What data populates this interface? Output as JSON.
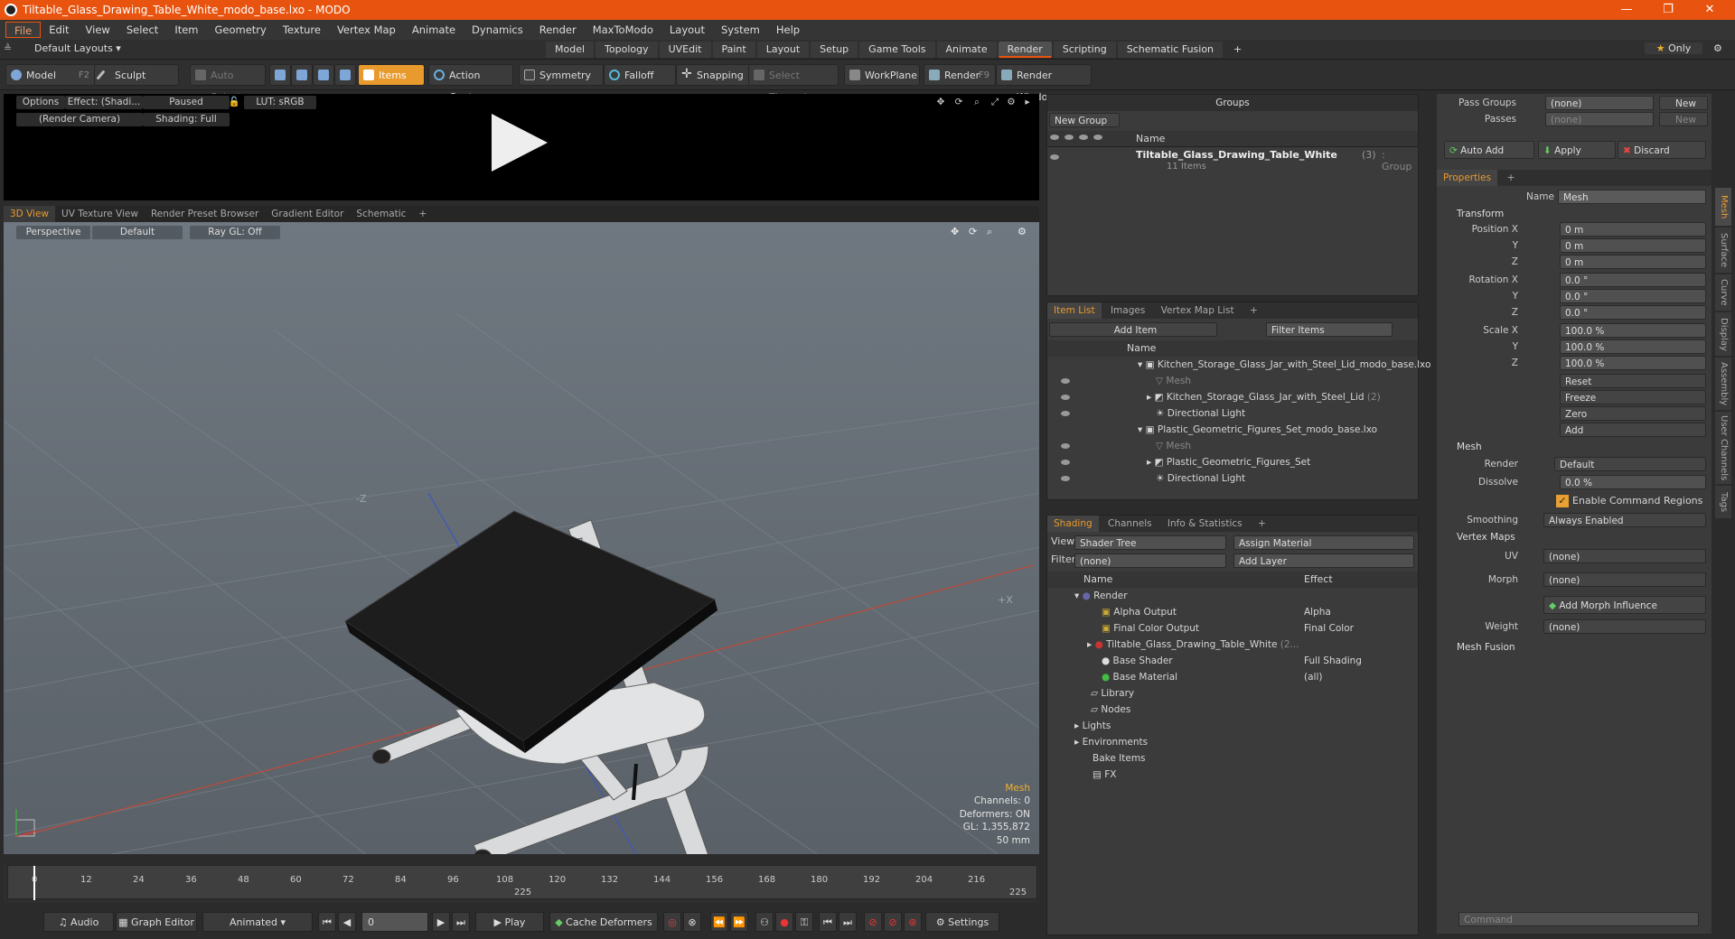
{
  "window": {
    "title": "Tiltable_Glass_Drawing_Table_White_modo_base.lxo - MODO"
  },
  "menu": [
    "File",
    "Edit",
    "View",
    "Select",
    "Item",
    "Geometry",
    "Texture",
    "Vertex Map",
    "Animate",
    "Dynamics",
    "Render",
    "MaxToModo",
    "Layout",
    "System",
    "Help"
  ],
  "layout": {
    "default_label": "Default Layouts ▾",
    "tabs": [
      "Model",
      "Topology",
      "UVEdit",
      "Paint",
      "Layout",
      "Setup",
      "Game Tools",
      "Animate",
      "Render",
      "Scripting",
      "Schematic Fusion"
    ],
    "selected_tab": "Render",
    "only_label": "Only"
  },
  "toolbar": {
    "model": "Model",
    "model_hotkey": "F2",
    "sculpt": "Sculpt",
    "auto_select": "Auto Select",
    "items": "Items",
    "action_center": "Action Center",
    "symmetry": "Symmetry",
    "falloff": "Falloff",
    "snapping": "Snapping",
    "select_through": "Select Through",
    "workplane": "WorkPlane",
    "render": "Render",
    "render_hotkey": "F9",
    "render_window": "Render Window"
  },
  "preview": {
    "options": "Options",
    "effect": "Effect: (Shadi...",
    "paused": "Paused",
    "lut": "LUT: sRGB",
    "camera": "(Render Camera)",
    "shading": "Shading: Full"
  },
  "viewport_tabs": [
    "3D View",
    "UV Texture View",
    "Render Preset Browser",
    "Gradient Editor",
    "Schematic"
  ],
  "viewport": {
    "perspective": "Perspective",
    "default": "Default",
    "raygl": "Ray GL: Off",
    "info_mesh": "Mesh",
    "info_channels": "Channels: 0",
    "info_deformers": "Deformers: ON",
    "info_gl": "GL: 1,355,872",
    "info_size": "50 mm",
    "axis_z": "-Z",
    "axis_x": "+X"
  },
  "timeline": {
    "ticks": [
      "0",
      "12",
      "24",
      "36",
      "48",
      "60",
      "72",
      "84",
      "96",
      "108",
      "120",
      "132",
      "144",
      "156",
      "168",
      "180",
      "192",
      "204",
      "216"
    ],
    "mid_label": "225",
    "end_label": "225"
  },
  "bottom": {
    "audio": "Audio",
    "graph_editor": "Graph Editor",
    "animated": "Animated",
    "frame": "0",
    "play": "Play",
    "cache_deformers": "Cache Deformers",
    "settings": "Settings"
  },
  "groups": {
    "title": "Groups",
    "new_group": "New Group",
    "col_name": "Name",
    "item_name": "Tiltable_Glass_Drawing_Table_White",
    "item_count": "(3)",
    "item_type": ": Group",
    "item_sub": "11 Items"
  },
  "itemlist": {
    "tabs": [
      "Item List",
      "Images",
      "Vertex Map List"
    ],
    "add_item": "Add Item",
    "filter": "Filter Items",
    "col_name": "Name",
    "rows": [
      {
        "name": "Kitchen_Storage_Glass_Jar_with_Steel_Lid_modo_base.lxo",
        "suffix": ""
      },
      {
        "name": "Mesh",
        "suffix": ""
      },
      {
        "name": "Kitchen_Storage_Glass_Jar_with_Steel_Lid",
        "suffix": "(2)"
      },
      {
        "name": "Directional Light",
        "suffix": ""
      },
      {
        "name": "Plastic_Geometric_Figures_Set_modo_base.lxo",
        "suffix": ""
      },
      {
        "name": "Mesh",
        "suffix": ""
      },
      {
        "name": "Plastic_Geometric_Figures_Set",
        "suffix": ""
      },
      {
        "name": "Directional Light",
        "suffix": ""
      }
    ]
  },
  "shading": {
    "tabs": [
      "Shading",
      "Channels",
      "Info & Statistics"
    ],
    "view_label": "View",
    "view_value": "Shader Tree",
    "assign": "Assign Material",
    "filter_label": "Filter",
    "filter_value": "(none)",
    "add_layer": "Add Layer",
    "col_name": "Name",
    "col_effect": "Effect",
    "rows": [
      {
        "name": "Render",
        "effect": ""
      },
      {
        "name": "Alpha Output",
        "effect": "Alpha"
      },
      {
        "name": "Final Color Output",
        "effect": "Final Color"
      },
      {
        "name": "Tiltable_Glass_Drawing_Table_White",
        "suffix": "(2...",
        "effect": ""
      },
      {
        "name": "Base Shader",
        "effect": "Full Shading"
      },
      {
        "name": "Base Material",
        "effect": "(all)"
      },
      {
        "name": "Library",
        "effect": ""
      },
      {
        "name": "Nodes",
        "effect": ""
      },
      {
        "name": "Lights",
        "effect": ""
      },
      {
        "name": "Environments",
        "effect": ""
      },
      {
        "name": "Bake Items",
        "effect": ""
      },
      {
        "name": "FX",
        "effect": ""
      }
    ]
  },
  "passes": {
    "pass_groups": "Pass Groups",
    "passes": "Passes",
    "none": "(none)",
    "new": "New",
    "auto_add": "Auto Add",
    "apply": "Apply",
    "discard": "Discard"
  },
  "properties": {
    "tab": "Properties",
    "name_label": "Name",
    "name_value": "Mesh",
    "transform": "Transform",
    "position_label": "Position X",
    "position": [
      "0 m",
      "0 m",
      "0 m"
    ],
    "rotation_label": "Rotation X",
    "rotation": [
      "0.0 °",
      "0.0 °",
      "0.0 °"
    ],
    "scale_label": "Scale X",
    "scale": [
      "100.0 %",
      "100.0 %",
      "100.0 %"
    ],
    "y": "Y",
    "z": "Z",
    "reset": "Reset",
    "freeze": "Freeze",
    "zero": "Zero",
    "add": "Add",
    "mesh_section": "Mesh",
    "render_label": "Render",
    "render_value": "Default",
    "dissolve_label": "Dissolve",
    "dissolve_value": "0.0 %",
    "enable_cmd": "Enable Command Regions",
    "smoothing_label": "Smoothing",
    "smoothing_value": "Always Enabled",
    "vertex_maps": "Vertex Maps",
    "uv_label": "UV",
    "uv_value": "(none)",
    "morph_label": "Morph",
    "morph_value": "(none)",
    "add_morph": "Add Morph Influence",
    "weight_label": "Weight",
    "weight_value": "(none)",
    "mesh_fusion": "Mesh Fusion",
    "side_tabs": [
      "Mesh",
      "Surface",
      "Curve",
      "Display",
      "Assembly",
      "User Channels",
      "Tags"
    ]
  },
  "command": {
    "placeholder": "Command"
  }
}
